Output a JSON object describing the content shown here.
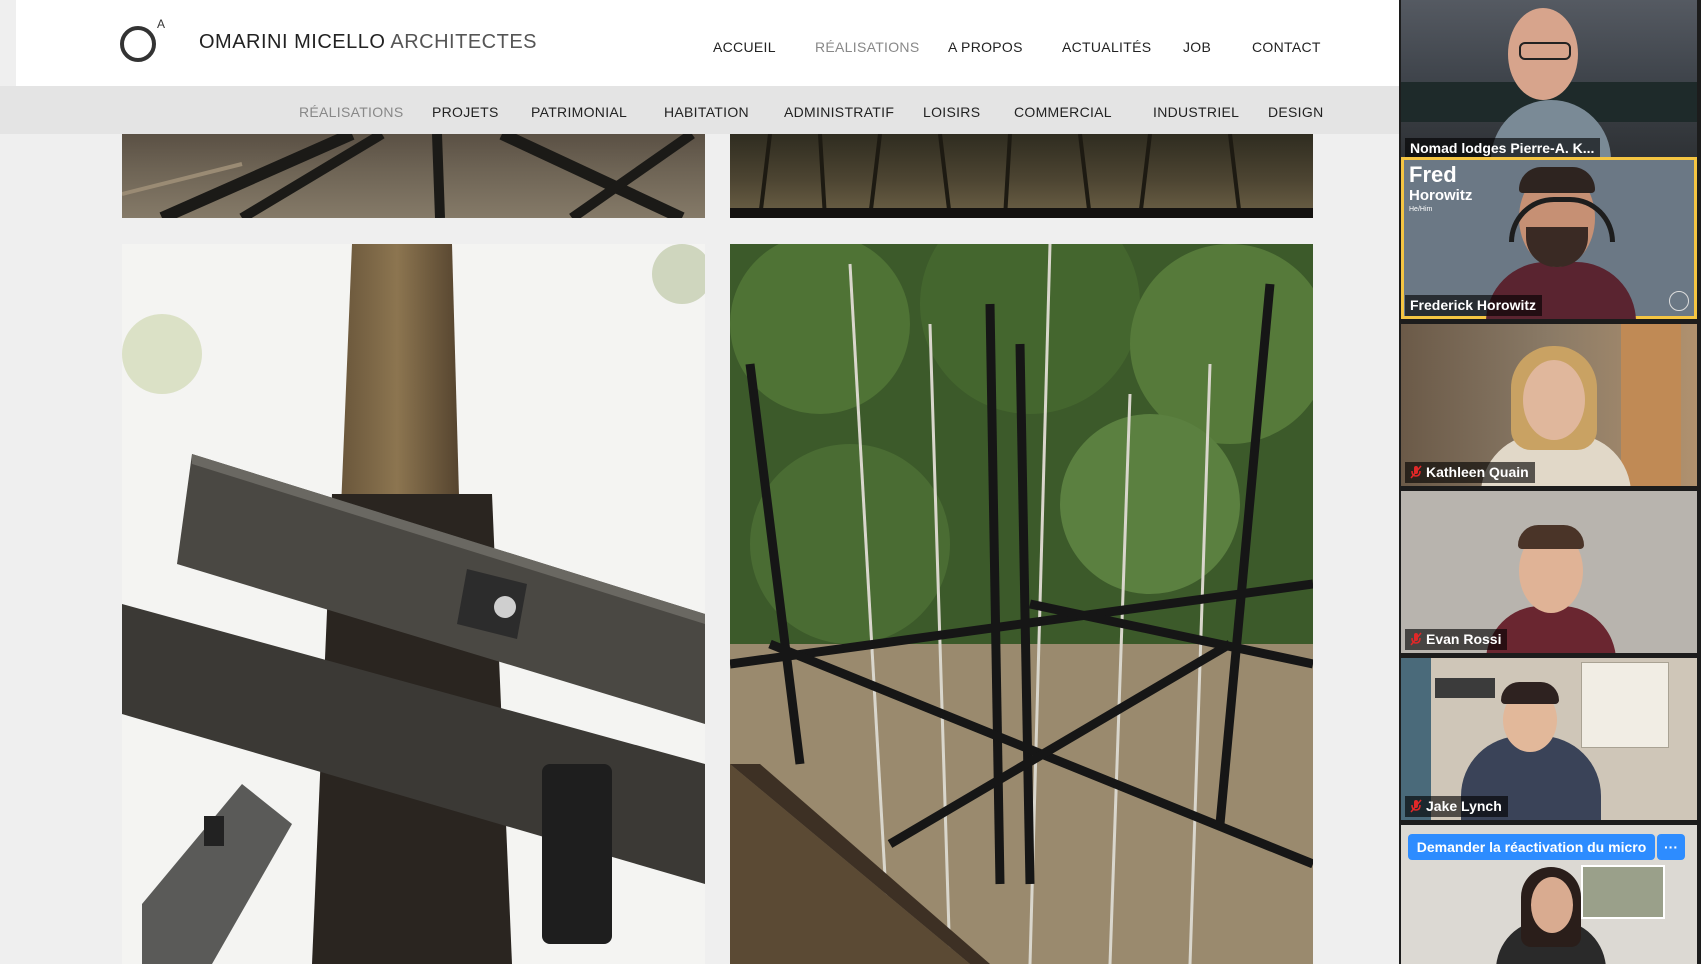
{
  "site": {
    "logo": {
      "superscript": "A",
      "name": "OMARINI MICELLO",
      "suffix": "ARCHITECTES"
    },
    "main_nav": [
      {
        "label": "ACCUEIL",
        "active": false
      },
      {
        "label": "RÉALISATIONS",
        "active": true
      },
      {
        "label": "A PROPOS",
        "active": false
      },
      {
        "label": "ACTUALITÉS",
        "active": false
      },
      {
        "label": "JOB",
        "active": false
      },
      {
        "label": "CONTACT",
        "active": false
      }
    ],
    "sub_nav": [
      {
        "label": "RÉALISATIONS",
        "active": true
      },
      {
        "label": "PROJETS",
        "active": false
      },
      {
        "label": "PATRIMONIAL",
        "active": false
      },
      {
        "label": "HABITATION",
        "active": false
      },
      {
        "label": "ADMINISTRATIF",
        "active": false
      },
      {
        "label": "LOISIRS",
        "active": false
      },
      {
        "label": "COMMERCIAL",
        "active": false
      },
      {
        "label": "INDUSTRIEL",
        "active": false
      },
      {
        "label": "DESIGN",
        "active": false
      }
    ]
  },
  "participants": [
    {
      "name": "Nomad lodges Pierre-A. K...",
      "muted": false,
      "active_speaker": false
    },
    {
      "name": "Frederick Horowitz",
      "overlay_first": "Fred",
      "overlay_last": "Horowitz",
      "overlay_pronouns": "He/Him",
      "muted": false,
      "active_speaker": true
    },
    {
      "name": "Kathleen Quain",
      "muted": true,
      "active_speaker": false
    },
    {
      "name": "Evan Rossi",
      "muted": true,
      "active_speaker": false
    },
    {
      "name": "Jake Lynch",
      "muted": true,
      "active_speaker": false
    }
  ],
  "unmute_request": {
    "label": "Demander la réactivation du micro",
    "more_label": "···"
  },
  "colors": {
    "active_speaker_border": "#f5c542",
    "unmute_button": "#2d8cff",
    "muted_icon": "#e02828"
  }
}
